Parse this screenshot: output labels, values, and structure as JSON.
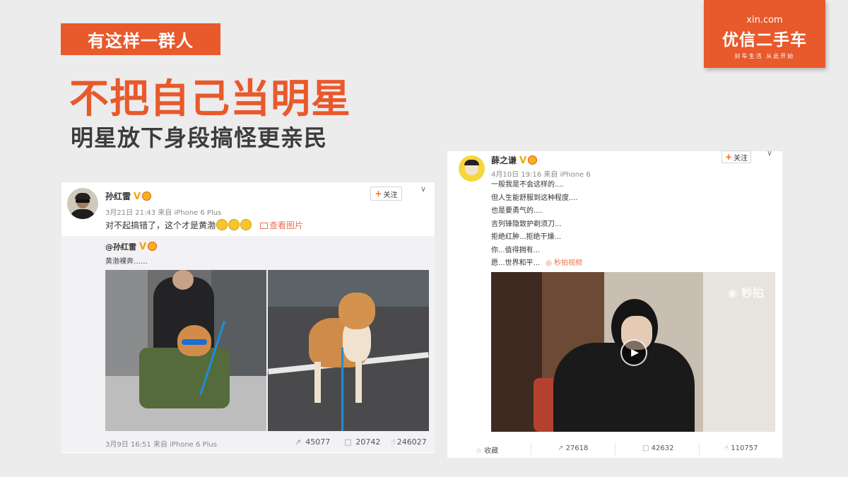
{
  "slide": {
    "tag": "有这样一群人",
    "headline": "不把自己当明星",
    "subline": "明星放下身段搞怪更亲民"
  },
  "logo": {
    "domain": "xin.com",
    "name": "优信二手车",
    "slogan": "好车生活 从此开始"
  },
  "left_post": {
    "user": "孙红雷",
    "badge_v": "V",
    "meta": "3月21日 21:43 来自 iPhone 6 Plus",
    "follow": "关注",
    "follow_plus": "+",
    "text": "对不起搞错了，这个才是黄渤",
    "view_images": "查看图片",
    "repost": {
      "user": "@孙红雷",
      "text": "黄渤裸奔……",
      "meta": "3月9日 16:51 来自 iPhone 6 Plus",
      "reposts": "45077",
      "comments": "20742",
      "likes": "246027"
    }
  },
  "right_post": {
    "user": "薛之谦",
    "badge_v": "V",
    "meta": "4月10日 19:16 来自 iPhone 6",
    "follow": "关注",
    "follow_plus": "+",
    "lines": [
      "一般我是不会这样的....",
      "但人生能舒服到这种程度....",
      "也是要勇气的....",
      "吉列锋隐致护剃须刀...",
      "拒绝红肿...拒绝干燥...",
      "你...值得拥有...",
      "愿...世界和平..."
    ],
    "video_link": "秒拍视频",
    "video_watermark": "秒拍",
    "actions": {
      "favorite": "收藏",
      "reposts": "27618",
      "comments": "42632",
      "likes": "110757"
    }
  },
  "colors": {
    "brand": "#e8592c",
    "link": "#eb7350",
    "background": "#ececec"
  }
}
